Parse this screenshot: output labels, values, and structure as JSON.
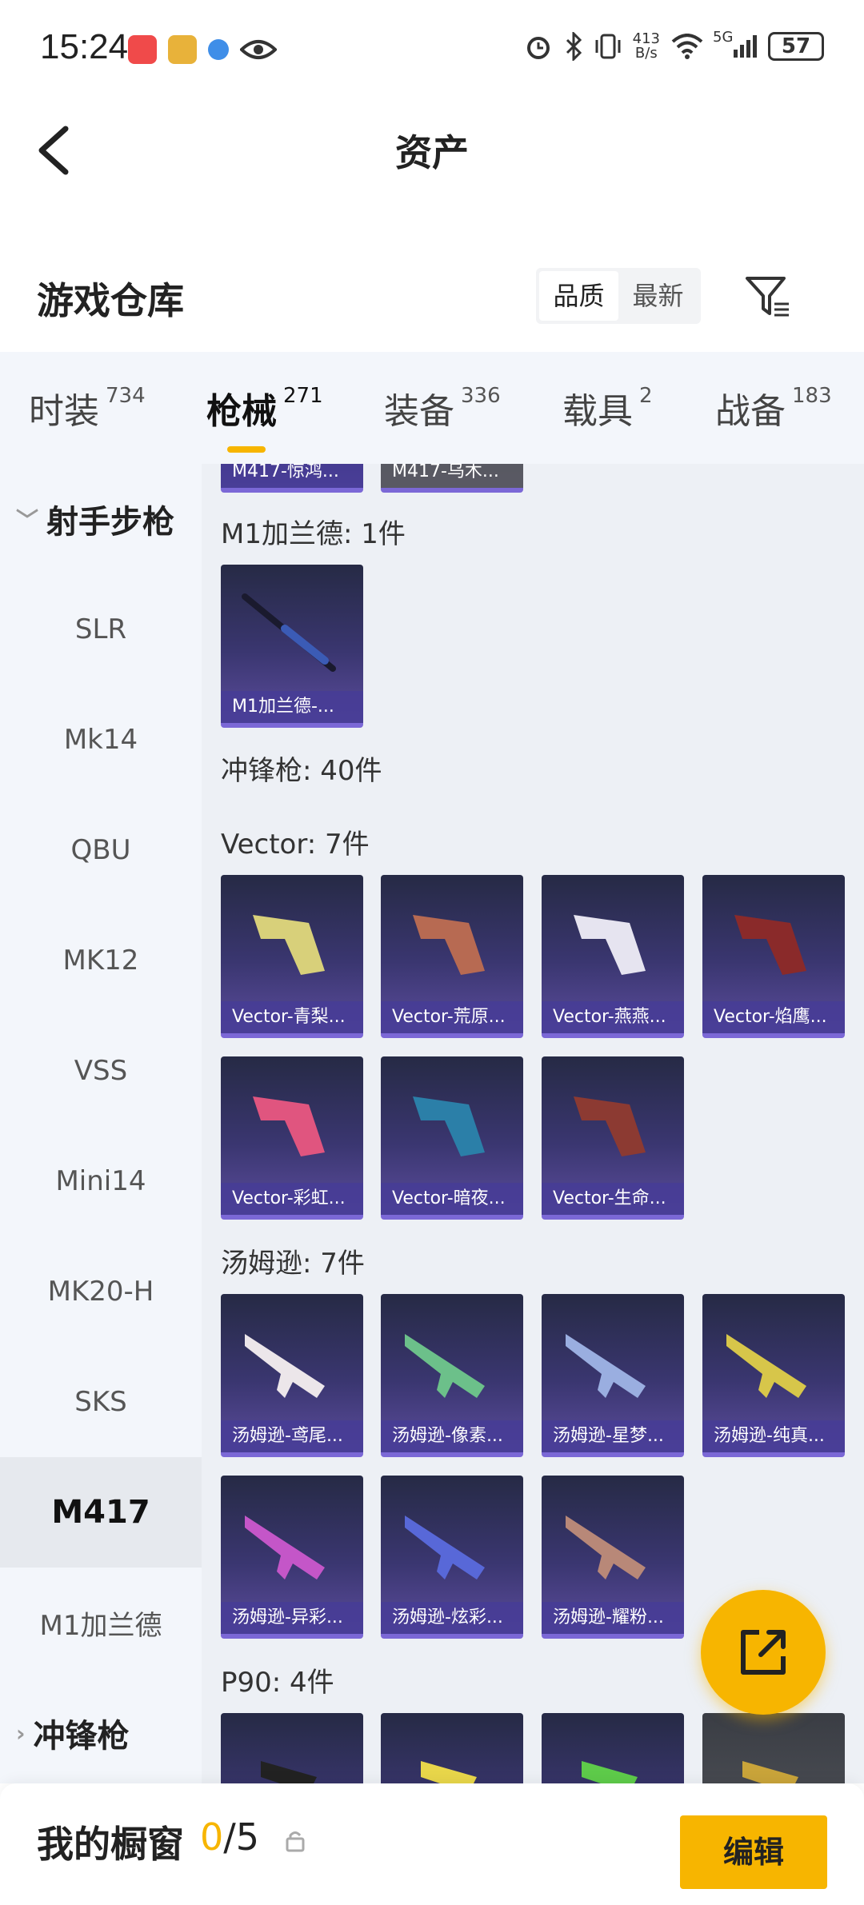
{
  "status": {
    "time": "15:24",
    "net_speed_top": "413",
    "net_speed_bottom": "B/s",
    "signal_label": "5G",
    "battery": "57"
  },
  "header": {
    "title": "资产"
  },
  "section": {
    "title": "游戏仓库",
    "sort_options": [
      "品质",
      "最新"
    ]
  },
  "tabs": [
    {
      "label": "时装",
      "count": "734"
    },
    {
      "label": "枪械",
      "count": "271"
    },
    {
      "label": "装备",
      "count": "336"
    },
    {
      "label": "载具",
      "count": "2"
    },
    {
      "label": "战备",
      "count": "183"
    }
  ],
  "sidebar": {
    "group1": "射手步枪",
    "items": [
      "SLR",
      "Mk14",
      "QBU",
      "MK12",
      "VSS",
      "Mini14",
      "MK20-H",
      "SKS",
      "M417",
      "M1加兰德"
    ],
    "group2": "冲锋枪"
  },
  "content": {
    "top_partial": [
      "M417-惊鸿...",
      "M417-乌木..."
    ],
    "m1_label": "M1加兰德: 1件",
    "m1_cards": [
      "M1加兰德-..."
    ],
    "smg_label": "冲锋枪: 40件",
    "vector_label": "Vector: 7件",
    "vector_cards": [
      "Vector-青梨...",
      "Vector-荒原...",
      "Vector-燕燕...",
      "Vector-焰鹰...",
      "Vector-彩虹...",
      "Vector-暗夜...",
      "Vector-生命..."
    ],
    "thompson_label": "汤姆逊: 7件",
    "thompson_cards": [
      "汤姆逊-鸢尾...",
      "汤姆逊-像素...",
      "汤姆逊-星梦...",
      "汤姆逊-纯真...",
      "汤姆逊-异彩...",
      "汤姆逊-炫彩...",
      "汤姆逊-耀粉..."
    ],
    "p90_label": "P90: 4件"
  },
  "bottom": {
    "title": "我的橱窗",
    "used": "0",
    "total": "/5",
    "edit_label": "编辑"
  },
  "colors": {
    "accent": "#f7b500",
    "card_bg": "#3a3670",
    "card_border": "#7b68d6"
  }
}
